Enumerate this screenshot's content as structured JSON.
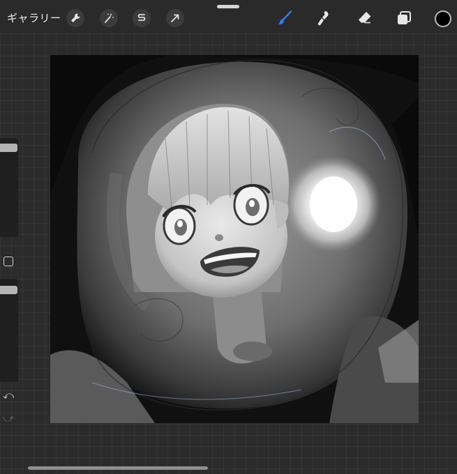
{
  "topbar": {
    "gallery_label": "ギャラリー",
    "left_tools": [
      {
        "icon": "wrench-icon"
      },
      {
        "icon": "magic-wand-icon"
      },
      {
        "icon": "selection-icon"
      },
      {
        "icon": "transform-arrow-icon"
      }
    ],
    "right_tools": [
      {
        "icon": "brush-icon",
        "active": true,
        "color": "#2f7ef6"
      },
      {
        "icon": "smudge-icon"
      },
      {
        "icon": "eraser-icon"
      },
      {
        "icon": "layers-icon"
      }
    ],
    "current_color": "#000000"
  },
  "sidebar": {
    "brush_size_level": 0.03,
    "opacity_level": 0.03,
    "undo_glyph": "⤺",
    "redo_glyph": "⤻"
  },
  "canvas": {
    "background": "#0e0e0e"
  }
}
